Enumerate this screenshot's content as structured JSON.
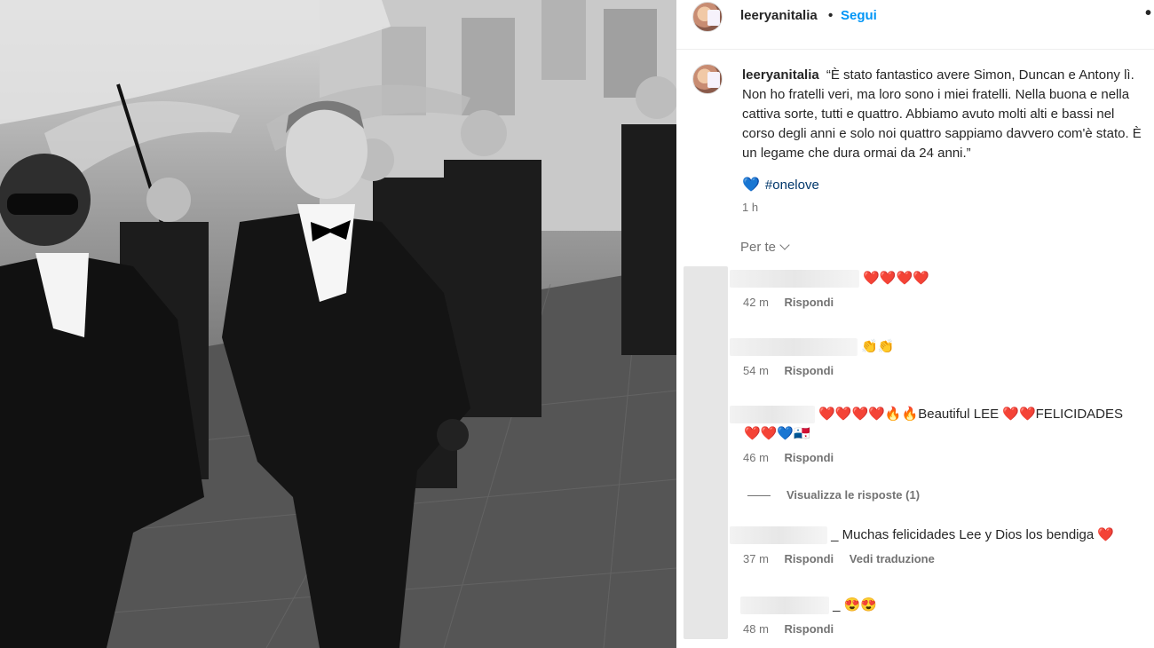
{
  "post": {
    "username": "leeryanitalia",
    "separator": "•",
    "follow_label": "Segui",
    "more_label": "•",
    "caption": "“È stato fantastico avere Simon, Duncan e Antony lì. Non ho fratelli veri, ma loro sono i miei fratelli. Nella buona e nella cattiva sorte, tutti e quattro. Abbiamo avuto molti alti e bassi nel corso degli anni e solo noi quattro sappiamo davvero com'è stato. È un legame che dura ormai da 24 anni.”",
    "hashtag_emoji": "💙",
    "hashtag": "#onelove",
    "time": "1 h"
  },
  "comments_filter": {
    "label": "Per te"
  },
  "comments": [
    {
      "text": "❤️❤️❤️❤️",
      "time": "42 m",
      "reply": "Rispondi"
    },
    {
      "text": "👏👏",
      "time": "54 m",
      "reply": "Rispondi"
    },
    {
      "text": "❤️❤️❤️❤️🔥🔥Beautiful LEE ❤️❤️FELICIDADES",
      "text2": "❤️❤️💙🇵🇦",
      "time": "46 m",
      "reply": "Rispondi"
    },
    {
      "text": "_ Muchas felicidades Lee y Dios los bendiga ❤️",
      "time": "37 m",
      "reply": "Rispondi",
      "translate": "Vedi traduzione"
    },
    {
      "text": "_ 😍😍",
      "time": "48 m",
      "reply": "Rispondi"
    }
  ],
  "view_replies": "Visualizza le risposte (1)"
}
